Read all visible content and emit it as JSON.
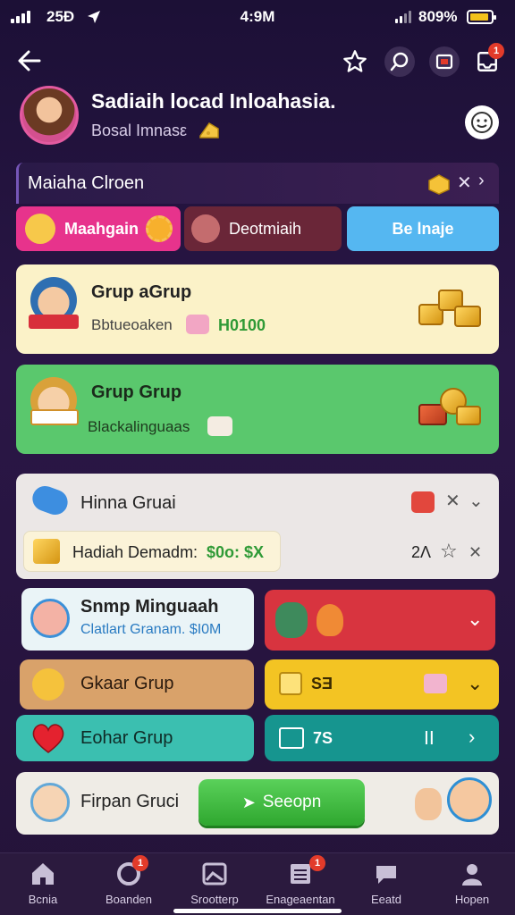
{
  "status_bar": {
    "left_time": "25Ɖ",
    "center_time": "4:9M",
    "battery_text": "809%"
  },
  "header": {
    "title": "Sadiaih locad Inloahasia.",
    "subtitle": "Bosal Imnasε",
    "notification_count": "1"
  },
  "section": {
    "title": "Maiaha Clroen",
    "tabs": [
      "Maahgain",
      "Deotmiaih",
      "Be lnaje"
    ]
  },
  "groups": [
    {
      "title": "Grup aGrup",
      "subtitle": "Bbtueoaken",
      "amount": "H0100"
    },
    {
      "title": "Grup Grup",
      "subtitle": "Blackalinguaas"
    }
  ],
  "panel": {
    "title": "Hinna Gruai",
    "reward_text": "Hadiah Demadm:",
    "reward_value": "$0o: $X",
    "count": "2Ʌ"
  },
  "tiles": [
    {
      "title": "Snmp Minguaah",
      "subtitle": "Clatlart Granam. $I0M"
    },
    {
      "title": "Gkaar Grup"
    },
    {
      "title": "Eohar Grup"
    }
  ],
  "tile_right": {
    "yellow_label": "ЅƎ",
    "teal_label": "7S",
    "teal_value": "ⅠⅠ"
  },
  "bottom_card": {
    "title": "Firpan Gruci",
    "button_label": "Seeopn"
  },
  "nav": [
    {
      "label": "Bcnia",
      "badge": ""
    },
    {
      "label": "Boanden",
      "badge": "1"
    },
    {
      "label": "Srootterp",
      "badge": ""
    },
    {
      "label": "Enageaentan",
      "badge": "1"
    },
    {
      "label": "Eeatd",
      "badge": ""
    },
    {
      "label": "Hopen",
      "badge": ""
    }
  ],
  "colors": {
    "background": "#241339",
    "pink": "#e7338c",
    "maroon": "#6a2638",
    "sky": "#55b7f1",
    "cream": "#fbf2c8",
    "green": "#5ac86d",
    "red": "#d8343f",
    "tan": "#d9a26a",
    "yellow": "#f3c423",
    "teal": "#3bbfb0",
    "dark_teal": "#16958f",
    "button_green": "#3fbf3f"
  }
}
